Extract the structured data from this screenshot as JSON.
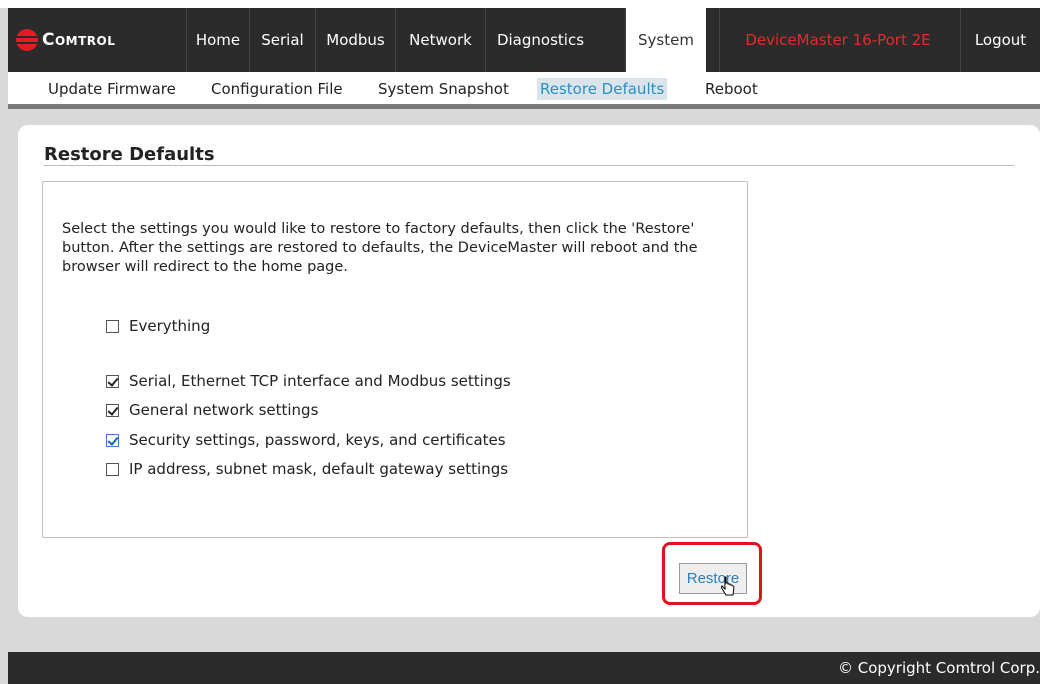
{
  "brand": {
    "name": "Comtrol",
    "logo_icon": "comtrol-logo-icon",
    "accent": "#e31b23"
  },
  "nav": {
    "items": [
      {
        "label": "Home"
      },
      {
        "label": "Serial"
      },
      {
        "label": "Modbus"
      },
      {
        "label": "Network"
      },
      {
        "label": "Diagnostics"
      },
      {
        "label": "System",
        "active": true
      }
    ],
    "device_name": "DeviceMaster 16-Port 2E",
    "logout": "Logout"
  },
  "subnav": {
    "items": [
      {
        "label": "Update Firmware"
      },
      {
        "label": "Configuration File"
      },
      {
        "label": "System Snapshot"
      },
      {
        "label": "Restore Defaults",
        "active": true
      },
      {
        "label": "Reboot"
      }
    ]
  },
  "main": {
    "title": "Restore Defaults",
    "description": "Select the settings you would like to restore to factory defaults, then click the 'Restore' button. After the settings are restored to defaults, the DeviceMaster will reboot and the browser will redirect to the home page.",
    "options": [
      {
        "label": "Everything",
        "checked": false
      },
      {
        "label": "Serial, Ethernet TCP interface and Modbus settings",
        "checked": true
      },
      {
        "label": "General network settings",
        "checked": true
      },
      {
        "label": "Security settings, password, keys, and certificates",
        "checked": true
      },
      {
        "label": "IP address, subnet mask, default gateway settings",
        "checked": false
      }
    ],
    "restore_button": "Restore",
    "highlight_color": "#e0141b"
  },
  "footer": {
    "copyright": "© Copyright Comtrol Corp."
  }
}
